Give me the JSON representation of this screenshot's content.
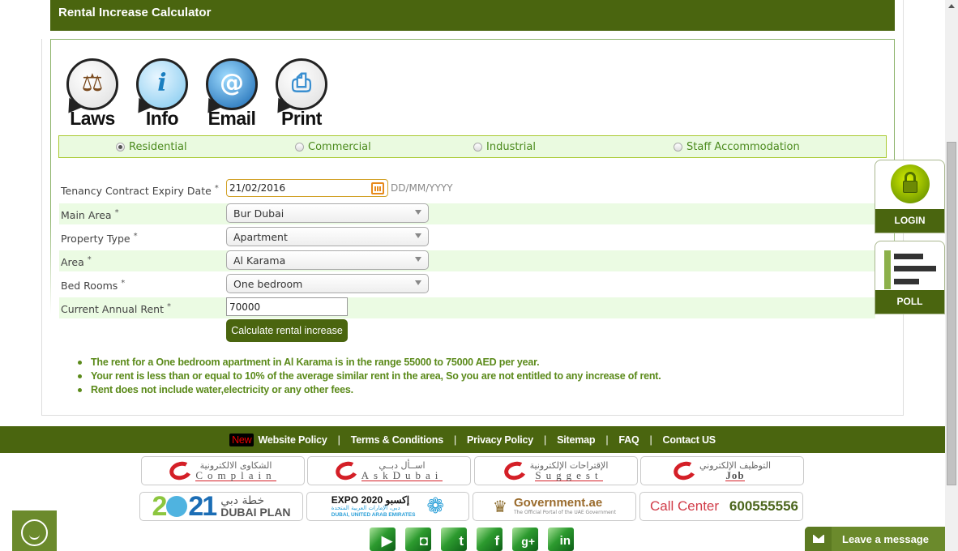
{
  "title": "Rental Increase Calculator",
  "toolbar": {
    "items": [
      {
        "label": "Laws",
        "icon": "gavel-icon",
        "glyph": "⚖"
      },
      {
        "label": "Info",
        "icon": "info-icon",
        "glyph": "i"
      },
      {
        "label": "Email",
        "icon": "email-icon",
        "glyph": "@"
      },
      {
        "label": "Print",
        "icon": "printer-icon",
        "glyph": "⎙"
      }
    ]
  },
  "property_categories": {
    "options": [
      "Residential",
      "Commercial",
      "Industrial",
      "Staff Accommodation"
    ],
    "selected": "Residential"
  },
  "form": {
    "expiry_date": {
      "label": "Tenancy Contract Expiry Date",
      "required": "*",
      "value": "21/02/2016",
      "hint": "DD/MM/YYYY"
    },
    "main_area": {
      "label": "Main Area",
      "required": "*",
      "value": "Bur Dubai"
    },
    "property_type": {
      "label": "Property Type",
      "required": "*",
      "value": "Apartment"
    },
    "area": {
      "label": "Area",
      "required": "*",
      "value": "Al Karama"
    },
    "bed_rooms": {
      "label": "Bed Rooms",
      "required": "*",
      "value": "One bedroom"
    },
    "annual_rent": {
      "label": "Current Annual Rent",
      "required": "*",
      "value": "70000"
    },
    "submit_label": "Calculate rental increase"
  },
  "results": [
    "The rent for a One bedroom apartment in Al Karama is in the range 55000 to 75000 AED per year.",
    "Your rent is less than or equal to 10% of the average similar rent in the area, So you are not entitled to any increase of rent.",
    "Rent does not include water,electricity or any other fees."
  ],
  "side_widgets": {
    "login_label": "LOGIN",
    "poll_label": "POLL"
  },
  "footer": {
    "new_badge": "New",
    "links": [
      "Website Policy",
      "Terms & Conditions",
      "Privacy Policy",
      "Sitemap",
      "FAQ",
      "Contact US"
    ],
    "separator": "|"
  },
  "banners": {
    "complain": {
      "ar": "الشكاوى الالكترونية",
      "en": "Complain"
    },
    "askdubai": {
      "ar": "اســأل دبــي",
      "en": "AskDubai"
    },
    "suggest": {
      "ar": "الإقتراحات الإلكترونية",
      "en": "Suggest"
    },
    "job": {
      "ar": "التوظيف الإلكتروني",
      "en": "Job"
    },
    "dubai_plan": {
      "year_a": "2",
      "year_b": "21",
      "ar": "خطة دبي",
      "en": "DUBAI PLAN"
    },
    "expo": {
      "en": "EXPO 2020",
      "ar": "إكسبو",
      "sub_ar": "دبي، الإمارات العربية المتحدة",
      "sub_en": "DUBAI, UNITED ARAB EMIRATES"
    },
    "government": {
      "title": "Government.ae",
      "subtitle": "The Official Portal of the UAE Government"
    },
    "call_center": {
      "label": "Call Center",
      "number": "600555556"
    }
  },
  "social": [
    {
      "name": "youtube",
      "glyph": "▶"
    },
    {
      "name": "instagram",
      "glyph": "◘"
    },
    {
      "name": "twitter",
      "glyph": "t"
    },
    {
      "name": "facebook",
      "glyph": "f"
    },
    {
      "name": "google-plus",
      "glyph": "g+"
    },
    {
      "name": "linkedin",
      "glyph": "in"
    }
  ],
  "chat": {
    "leave_message": "Leave a message"
  }
}
